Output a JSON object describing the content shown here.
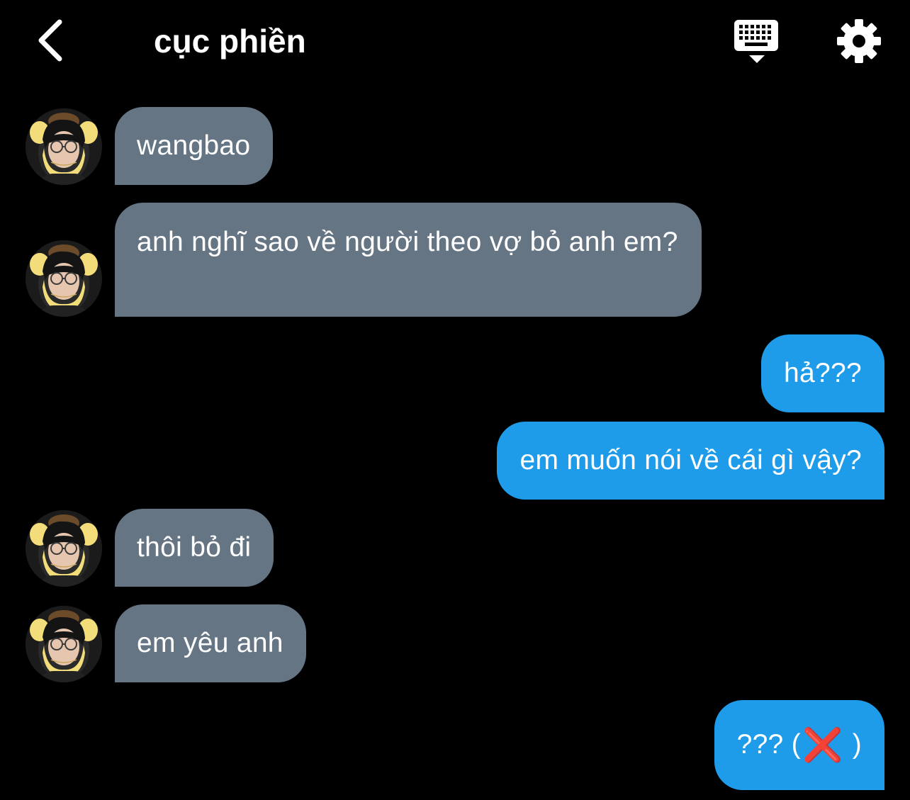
{
  "header": {
    "title": "cục phiền",
    "back_icon": "chevron-left-icon",
    "keyboard_icon": "keyboard-icon",
    "settings_icon": "gear-icon"
  },
  "colors": {
    "background": "#000000",
    "incoming_bubble": "#657584",
    "outgoing_bubble": "#1e9be9",
    "text": "#ffffff",
    "x_mark": "#e1141c"
  },
  "messages": [
    {
      "side": "in",
      "text": "wangbao"
    },
    {
      "side": "in",
      "text": "anh nghĩ sao về người theo vợ bỏ anh em?"
    },
    {
      "side": "out",
      "text": "hả???"
    },
    {
      "side": "out",
      "text": "em muốn nói về cái gì vậy?"
    },
    {
      "side": "in",
      "text": "thôi bỏ đi"
    },
    {
      "side": "in",
      "text": "em yêu anh"
    },
    {
      "side": "out",
      "text_before": "??? (",
      "emoji": "❌",
      "text_after": " )"
    }
  ]
}
